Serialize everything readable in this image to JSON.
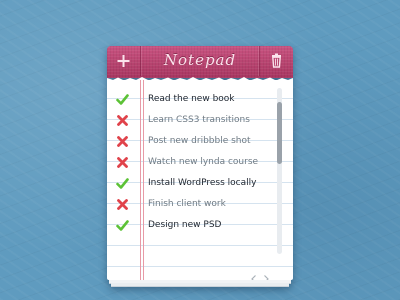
{
  "header": {
    "title": "Notepad",
    "add_icon": "plus-icon",
    "trash_icon": "trash-icon",
    "color": "#b94270"
  },
  "list": {
    "items": [
      {
        "label": "Read the new book",
        "status": "done",
        "icon": "check-icon"
      },
      {
        "label": "Learn CSS3 transitions",
        "status": "todo",
        "icon": "cross-icon"
      },
      {
        "label": "Post new dribbble shot",
        "status": "todo",
        "icon": "cross-icon"
      },
      {
        "label": "Watch new lynda course",
        "status": "todo",
        "icon": "cross-icon"
      },
      {
        "label": "Install WordPress locally",
        "status": "done",
        "icon": "check-icon"
      },
      {
        "label": "Finish client work",
        "status": "todo",
        "icon": "cross-icon"
      },
      {
        "label": "Design new PSD",
        "status": "done",
        "icon": "check-icon"
      }
    ]
  },
  "pager": {
    "prev_icon": "chevron-left-icon",
    "next_icon": "chevron-right-icon"
  },
  "colors": {
    "background": "#5f9bbf",
    "check": "#5cc236",
    "cross": "#e0434b",
    "margin_line": "#e79aa6",
    "rule_line": "#d5e3ef"
  }
}
